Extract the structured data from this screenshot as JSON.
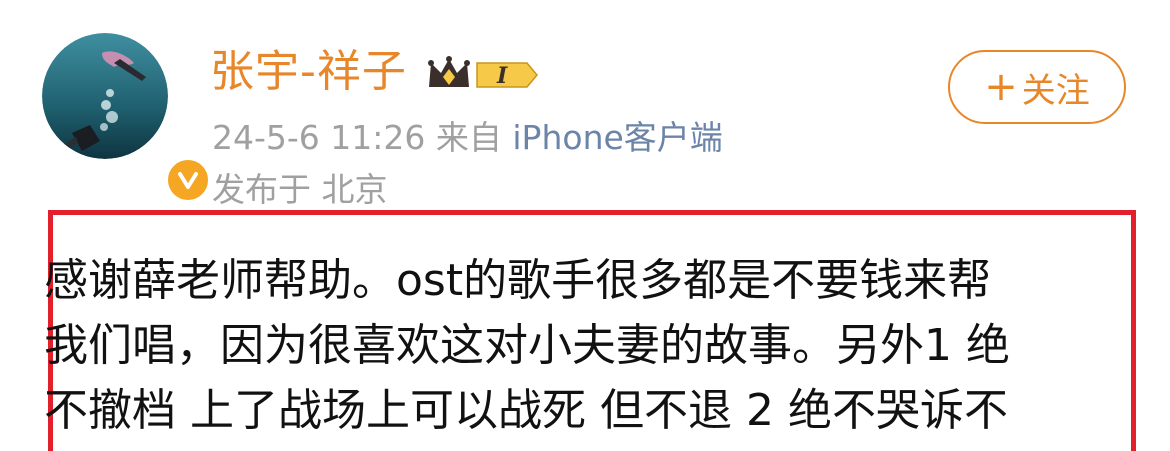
{
  "post": {
    "username": "张宇-祥子",
    "vip_level": "I",
    "timestamp": "24-5-6 11:26",
    "source_prefix": "来自",
    "source": "iPhone客户端",
    "location": "发布于 北京",
    "follow_label": "关注",
    "follow_plus": "+",
    "content_lines": [
      "感谢薛老师帮助。ost的歌手很多都是不要钱来帮",
      "我们唱，因为很喜欢这对小夫妻的故事。另外1 绝",
      "不撤档 上了战场上可以战死 但不退 2  绝不哭诉不"
    ]
  },
  "colors": {
    "username": "#e8862a",
    "accent": "#e8862a",
    "meta": "#a0a0a0",
    "source_link": "#6b84a8",
    "highlight_border": "#e2202b",
    "verified": "#f5a623",
    "text": "#111111"
  },
  "icons": {
    "avatar": "diver-photo-avatar",
    "verified": "verified-v-icon",
    "vip": "crown-vip-icon"
  }
}
